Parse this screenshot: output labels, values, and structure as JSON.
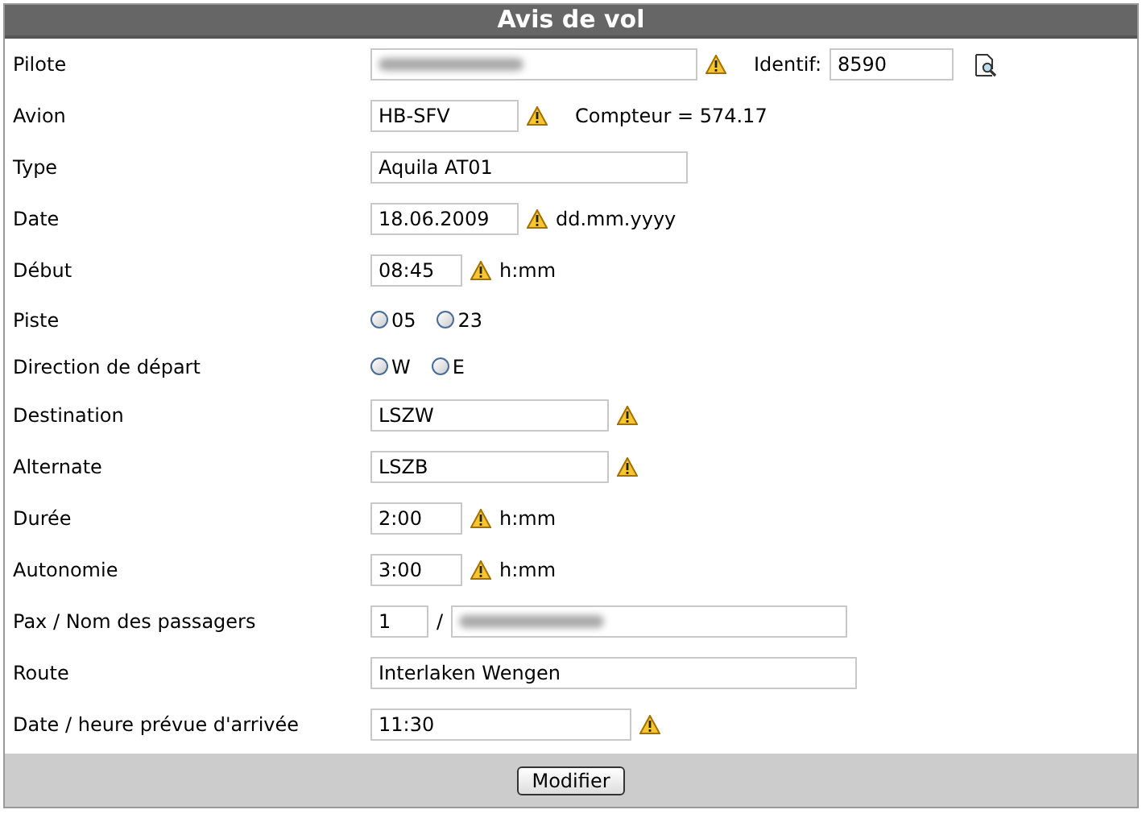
{
  "title": "Avis de vol",
  "rows": [
    {
      "label": "Pilote",
      "items": [
        {
          "kind": "input",
          "blurred": true,
          "warning": true
        },
        {
          "kind": "text",
          "text": "Identif:"
        },
        {
          "kind": "input",
          "value": "8590",
          "warning": false
        },
        {
          "kind": "lookup"
        }
      ]
    },
    {
      "label": "Avion",
      "items": [
        {
          "kind": "input",
          "value": "HB-SFV",
          "warning": true
        },
        {
          "kind": "text",
          "text": "Compteur = 574.17"
        }
      ]
    },
    {
      "label": "Type",
      "items": [
        {
          "kind": "input",
          "value": "Aquila AT01",
          "warning": false
        }
      ]
    },
    {
      "label": "Date",
      "items": [
        {
          "kind": "input",
          "value": "18.06.2009",
          "warning": true
        },
        {
          "kind": "hint",
          "text": "dd.mm.yyyy"
        }
      ]
    },
    {
      "label": "Début",
      "items": [
        {
          "kind": "input",
          "value": "08:45",
          "warning": true
        },
        {
          "kind": "hint",
          "text": "h:mm"
        }
      ]
    },
    {
      "label": "Piste",
      "items": [
        {
          "kind": "radio",
          "text": "05",
          "selected": false
        },
        {
          "kind": "radio",
          "text": "23",
          "selected": false
        }
      ]
    },
    {
      "label": "Direction de départ",
      "items": [
        {
          "kind": "radio",
          "text": "W",
          "selected": false
        },
        {
          "kind": "radio",
          "text": "E",
          "selected": false
        }
      ]
    },
    {
      "label": "Destination",
      "items": [
        {
          "kind": "input",
          "value": "LSZW",
          "warning": true
        }
      ]
    },
    {
      "label": "Alternate",
      "items": [
        {
          "kind": "input",
          "value": "LSZB",
          "warning": true
        }
      ]
    },
    {
      "label": "Durée",
      "items": [
        {
          "kind": "input",
          "value": "2:00",
          "warning": true
        },
        {
          "kind": "hint",
          "text": "h:mm"
        }
      ]
    },
    {
      "label": "Autonomie",
      "items": [
        {
          "kind": "input",
          "value": "3:00",
          "warning": true
        },
        {
          "kind": "hint",
          "text": "h:mm"
        }
      ]
    },
    {
      "label": "Pax / Nom des passagers",
      "items": [
        {
          "kind": "input",
          "value": "1",
          "warning": false
        },
        {
          "kind": "text",
          "text": "/"
        },
        {
          "kind": "input",
          "blurred": true,
          "warning": false
        }
      ]
    },
    {
      "label": "Route",
      "items": [
        {
          "kind": "input",
          "value": "Interlaken Wengen",
          "warning": false
        }
      ]
    },
    {
      "label": "Date / heure prévue d'arrivée",
      "items": [
        {
          "kind": "input",
          "value": "11:30",
          "warning": true
        }
      ]
    }
  ],
  "submit": "Modifier"
}
